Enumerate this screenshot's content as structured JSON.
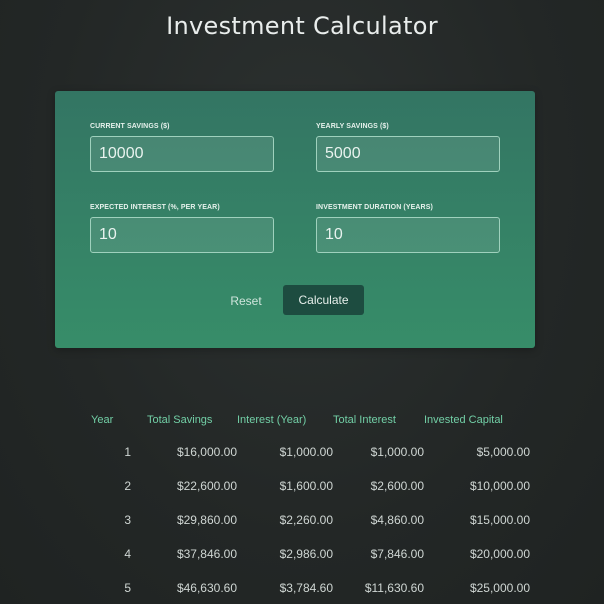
{
  "header": {
    "title": "Investment Calculator"
  },
  "form": {
    "current_savings": {
      "label": "CURRENT SAVINGS ($)",
      "value": "10000"
    },
    "yearly_savings": {
      "label": "YEARLY SAVINGS ($)",
      "value": "5000"
    },
    "expected_interest": {
      "label": "EXPECTED INTEREST (%, PER YEAR)",
      "value": "10"
    },
    "investment_duration": {
      "label": "INVESTMENT DURATION (YEARS)",
      "value": "10"
    },
    "reset_label": "Reset",
    "calculate_label": "Calculate"
  },
  "results": {
    "columns": [
      "Year",
      "Total Savings",
      "Interest (Year)",
      "Total Interest",
      "Invested Capital"
    ],
    "rows": [
      [
        "1",
        "$16,000.00",
        "$1,000.00",
        "$1,000.00",
        "$5,000.00"
      ],
      [
        "2",
        "$22,600.00",
        "$1,600.00",
        "$2,600.00",
        "$10,000.00"
      ],
      [
        "3",
        "$29,860.00",
        "$2,260.00",
        "$4,860.00",
        "$15,000.00"
      ],
      [
        "4",
        "$37,846.00",
        "$2,986.00",
        "$7,846.00",
        "$20,000.00"
      ],
      [
        "5",
        "$46,630.60",
        "$3,784.60",
        "$11,630.60",
        "$25,000.00"
      ]
    ]
  },
  "colors": {
    "background": "#232726",
    "card_top": "#337563",
    "card_bottom": "#378d69",
    "calculate_button": "#1d4c40",
    "table_header": "#72cfa6"
  }
}
